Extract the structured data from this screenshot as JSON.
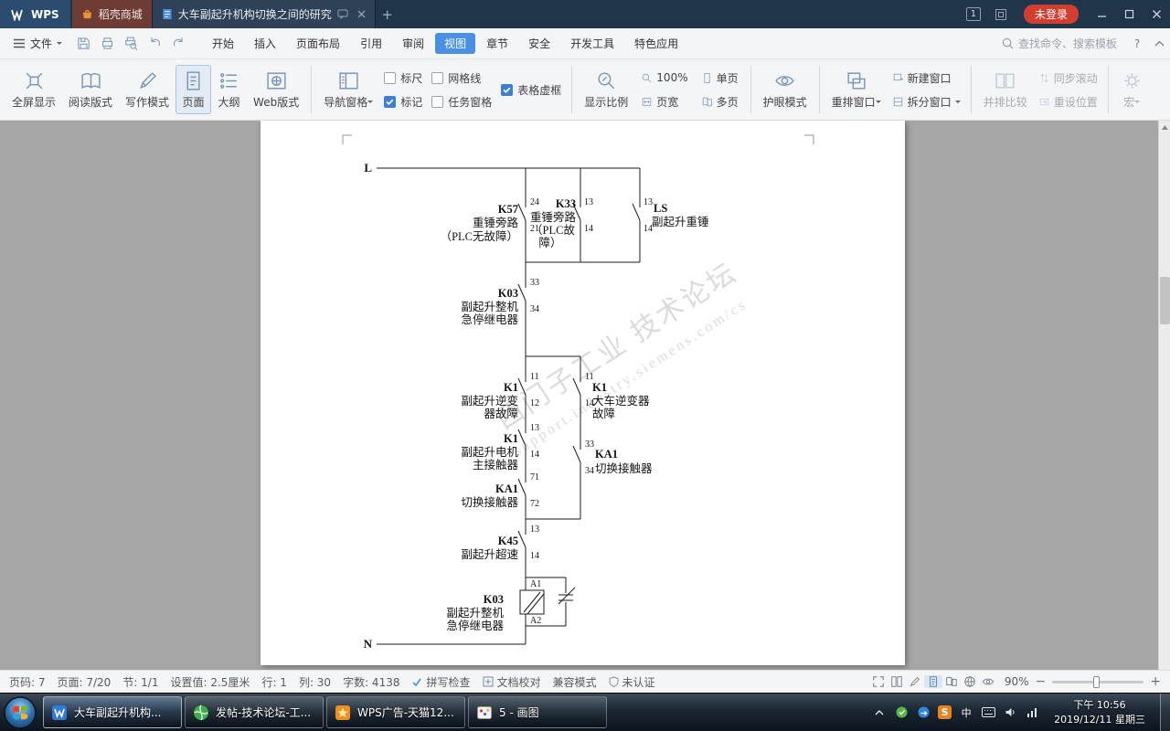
{
  "titlebar": {
    "wps": "WPS",
    "store_tab": "稻壳商城",
    "doc_tab": "大车副起升机构切换之间的研究",
    "new_tab": "+",
    "badge": "1",
    "login": "未登录"
  },
  "menubar": {
    "file": "文件",
    "tabs": [
      "开始",
      "插入",
      "页面布局",
      "引用",
      "审阅",
      "视图",
      "章节",
      "安全",
      "开发工具",
      "特色应用"
    ],
    "search": "查找命令、搜索模板",
    "help": "?"
  },
  "ribbon": {
    "fullscreen": "全屏显示",
    "reading": "阅读版式",
    "writing": "写作模式",
    "page": "页面",
    "outline": "大纲",
    "web": "Web版式",
    "nav_pane": "导航窗格",
    "ruler": "标尺",
    "gridlines": "网格线",
    "table_borders": "表格虚框",
    "marks": "标记",
    "task_pane": "任务窗格",
    "zoom": "显示比例",
    "zoom_100": "100%",
    "one_page": "单页",
    "page_width": "页宽",
    "multi_page": "多页",
    "eye_mode": "护眼模式",
    "rearrange": "重排窗口",
    "new_window": "新建窗口",
    "split": "拆分窗口",
    "side_by_side": "并排比较",
    "sync_scroll": "同步滚动",
    "reset_pos": "重设位置",
    "macro": "宏"
  },
  "diagram": {
    "rail_l": "L",
    "rail_n": "N",
    "wm1": "西门子工业 技术论坛",
    "wm2": "support.industry.siemens.com/cs",
    "k57": {
      "n": "K57",
      "a": "重锤旁路",
      "b": "（PLC无故障）",
      "p1": "24",
      "p2": "21"
    },
    "k33": {
      "n": "K33",
      "a": "重锤旁路",
      "b": "（PLC故",
      "c": "障）",
      "p1": "13",
      "p2": "14"
    },
    "ls": {
      "n": "LS",
      "a": "副起升重锤",
      "p1": "13",
      "p2": "14"
    },
    "k03": {
      "n": "K03",
      "a": "副起升整机",
      "b": "急停继电器",
      "p1": "33",
      "p2": "34"
    },
    "k1a": {
      "n": "K1",
      "a": "副起升逆变",
      "b": "器故障",
      "p1": "11",
      "p2": "12"
    },
    "k1b": {
      "n": "K1",
      "a": "大车逆变器",
      "b": "故障",
      "p1": "11",
      "p2": "14"
    },
    "k1c": {
      "n": "K1",
      "a": "副起升电机",
      "b": "主接触器",
      "p1": "13",
      "p2": "14"
    },
    "ka1a": {
      "n": "KA1",
      "a": "切换接触器",
      "p1": "33",
      "p2": "34"
    },
    "ka1b": {
      "n": "KA1",
      "a": "切换接触器",
      "p1": "71",
      "p2": "72"
    },
    "k45": {
      "n": "K45",
      "a": "副起升超速",
      "p1": "13",
      "p2": "14"
    },
    "coil": {
      "n": "K03",
      "a": "副起升整机",
      "b": "急停继电器",
      "p1": "A1",
      "p2": "A2"
    }
  },
  "statusbar": {
    "page_no": "页码: 7",
    "page": "页面: 7/20",
    "section": "节: 1/1",
    "setting": "设置值: 2.5厘米",
    "line": "行: 1",
    "col": "列: 30",
    "words": "字数: 4138",
    "spell": "拼写检查",
    "proof": "文档校对",
    "compat": "兼容模式",
    "cert": "未认证",
    "zoom": "90%"
  },
  "taskbar": {
    "buttons": [
      "大车副起升机构...",
      "发帖-技术论坛-工...",
      "WPS广告-天猫12...",
      "5 - 画图"
    ],
    "tray_s": "S",
    "ime": "中",
    "time": "下午 10:56",
    "date": "2019/12/11 星期三"
  }
}
